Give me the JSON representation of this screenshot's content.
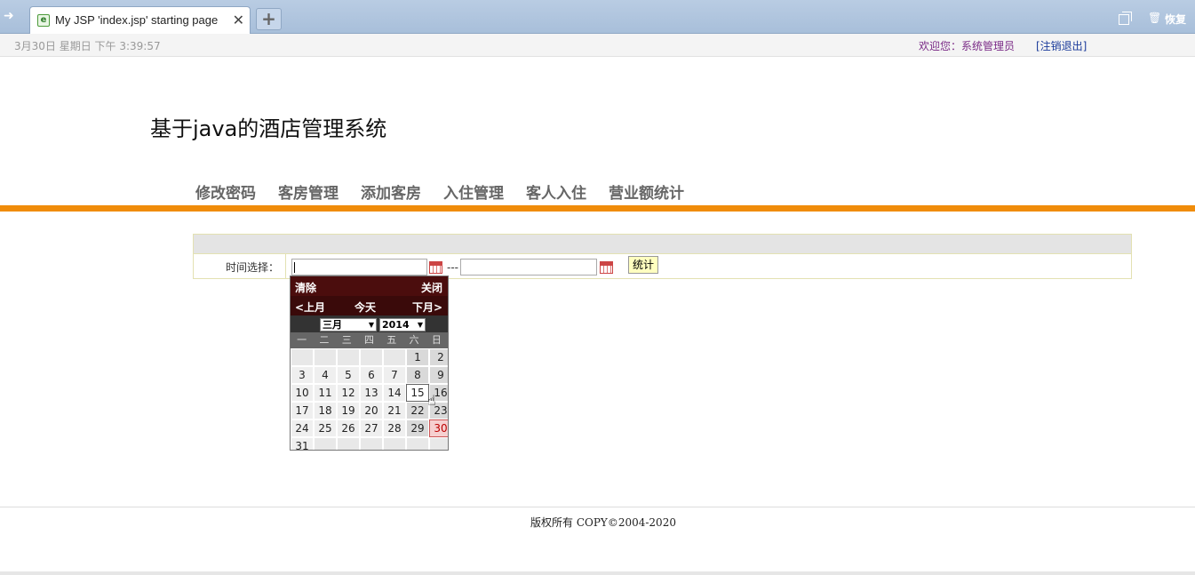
{
  "browser": {
    "tab_title": "My JSP 'index.jsp' starting page",
    "close_symbol": "✕",
    "new_tab_symbol": "+",
    "restore_label": "恢复"
  },
  "topbar": {
    "datetime": "3月30日 星期日 下午 3:39:57",
    "welcome": "欢迎您：系统管理员",
    "logout": "[注销退出]"
  },
  "header": {
    "title": "基于java的酒店管理系统"
  },
  "nav": {
    "items": [
      "修改密码",
      "客房管理",
      "添加客房",
      "入住管理",
      "客人入住",
      "营业额统计"
    ]
  },
  "form": {
    "time_label": "时间选择：",
    "range_separator": "---",
    "start_value": "",
    "end_value": "",
    "submit_label": "统计"
  },
  "calendar": {
    "clear": "清除",
    "close": "关闭",
    "prev": "<上月",
    "today": "今天",
    "next": "下月>",
    "month": "三月",
    "year": "2014",
    "weekdays": [
      "一",
      "二",
      "三",
      "四",
      "五",
      "六",
      "日"
    ],
    "weeks": [
      [
        "",
        "",
        "",
        "",
        "",
        "1",
        "2"
      ],
      [
        "3",
        "4",
        "5",
        "6",
        "7",
        "8",
        "9"
      ],
      [
        "10",
        "11",
        "12",
        "13",
        "14",
        "15",
        "16"
      ],
      [
        "17",
        "18",
        "19",
        "20",
        "21",
        "22",
        "23"
      ],
      [
        "24",
        "25",
        "26",
        "27",
        "28",
        "29",
        "30"
      ],
      [
        "31",
        "",
        "",
        "",
        "",
        "",
        ""
      ]
    ],
    "today_day": "15",
    "selected_day": "30"
  },
  "footer": {
    "copyright": "版权所有  COPY©2004-2020"
  },
  "colors": {
    "accent_orange": "#f08c0a",
    "calendar_header": "#4b0d0d"
  }
}
